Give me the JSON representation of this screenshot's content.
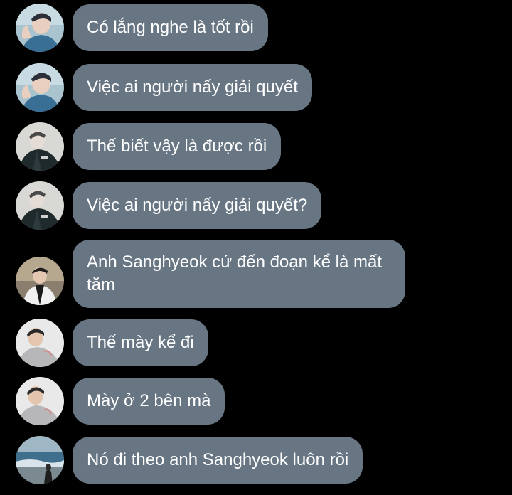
{
  "messages": [
    {
      "avatar": "avatar-person-a",
      "text": "Có lắng nghe là tốt rồi"
    },
    {
      "avatar": "avatar-person-a",
      "text": "Việc ai người nấy giải quyết"
    },
    {
      "avatar": "avatar-person-b",
      "text": "Thế biết vậy là được rồi"
    },
    {
      "avatar": "avatar-person-b",
      "text": "Việc ai người nấy giải quyết?"
    },
    {
      "avatar": "avatar-person-c",
      "text": "Anh Sanghyeok cứ đến đoạn kể là mất tăm"
    },
    {
      "avatar": "avatar-person-d",
      "text": "Thế mày kể đi"
    },
    {
      "avatar": "avatar-person-d",
      "text": "Mày ở 2 bên mà"
    },
    {
      "avatar": "avatar-person-e",
      "text": "Nó đi theo anh Sanghyeok luôn rồi"
    }
  ],
  "colors": {
    "background": "#000000",
    "bubble": "#687684",
    "text": "#ffffff"
  }
}
